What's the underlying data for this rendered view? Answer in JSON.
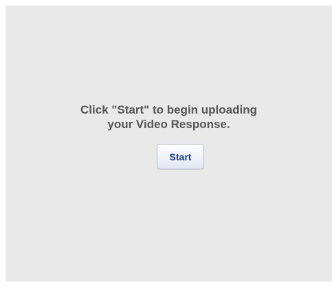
{
  "upload_prompt": {
    "line1": "Click \"Start\" to begin uploading",
    "line2": "your Video Response."
  },
  "start_button": {
    "label": "Start"
  },
  "colors": {
    "panel_background": "#e9e9e9",
    "message_text": "#555555",
    "button_text": "#1b3a8a"
  }
}
